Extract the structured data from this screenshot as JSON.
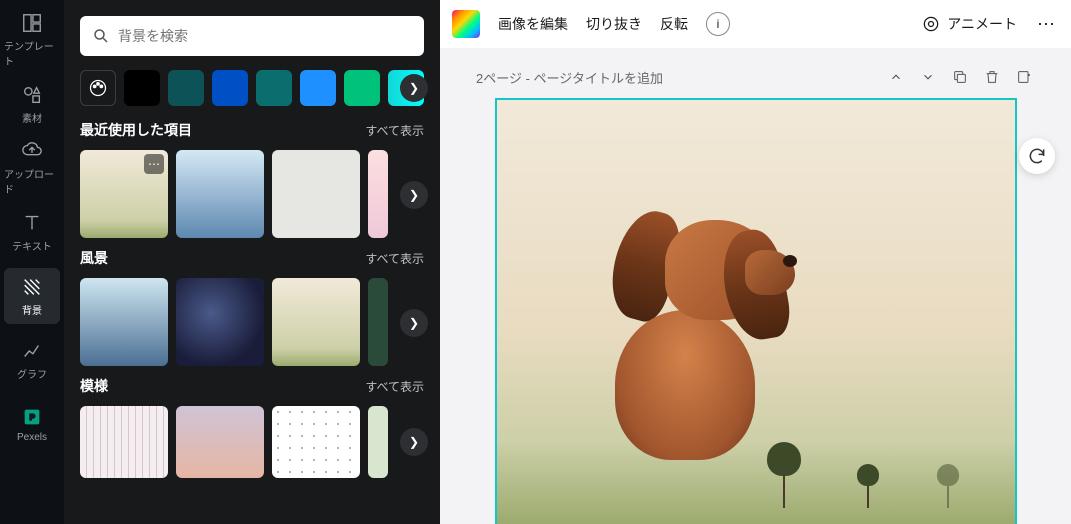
{
  "search": {
    "placeholder": "背景を検索"
  },
  "rail": {
    "template": "テンプレート",
    "elements": "素材",
    "upload": "アップロード",
    "text": "テキスト",
    "background": "背景",
    "graph": "グラフ",
    "pexels": "Pexels"
  },
  "colors": [
    "#000000",
    "#0d5257",
    "#004fc4",
    "#0a6e6e",
    "#1e90ff",
    "#00c27a",
    "#14d6d6"
  ],
  "sections": {
    "recent": {
      "title": "最近使用した項目",
      "all": "すべて表示"
    },
    "landscape": {
      "title": "風景",
      "all": "すべて表示"
    },
    "pattern": {
      "title": "模様",
      "all": "すべて表示"
    }
  },
  "toolbar": {
    "edit": "画像を編集",
    "crop": "切り抜き",
    "flip": "反転",
    "animate": "アニメート"
  },
  "page": {
    "label": "2ページ - ページタイトルを追加"
  }
}
